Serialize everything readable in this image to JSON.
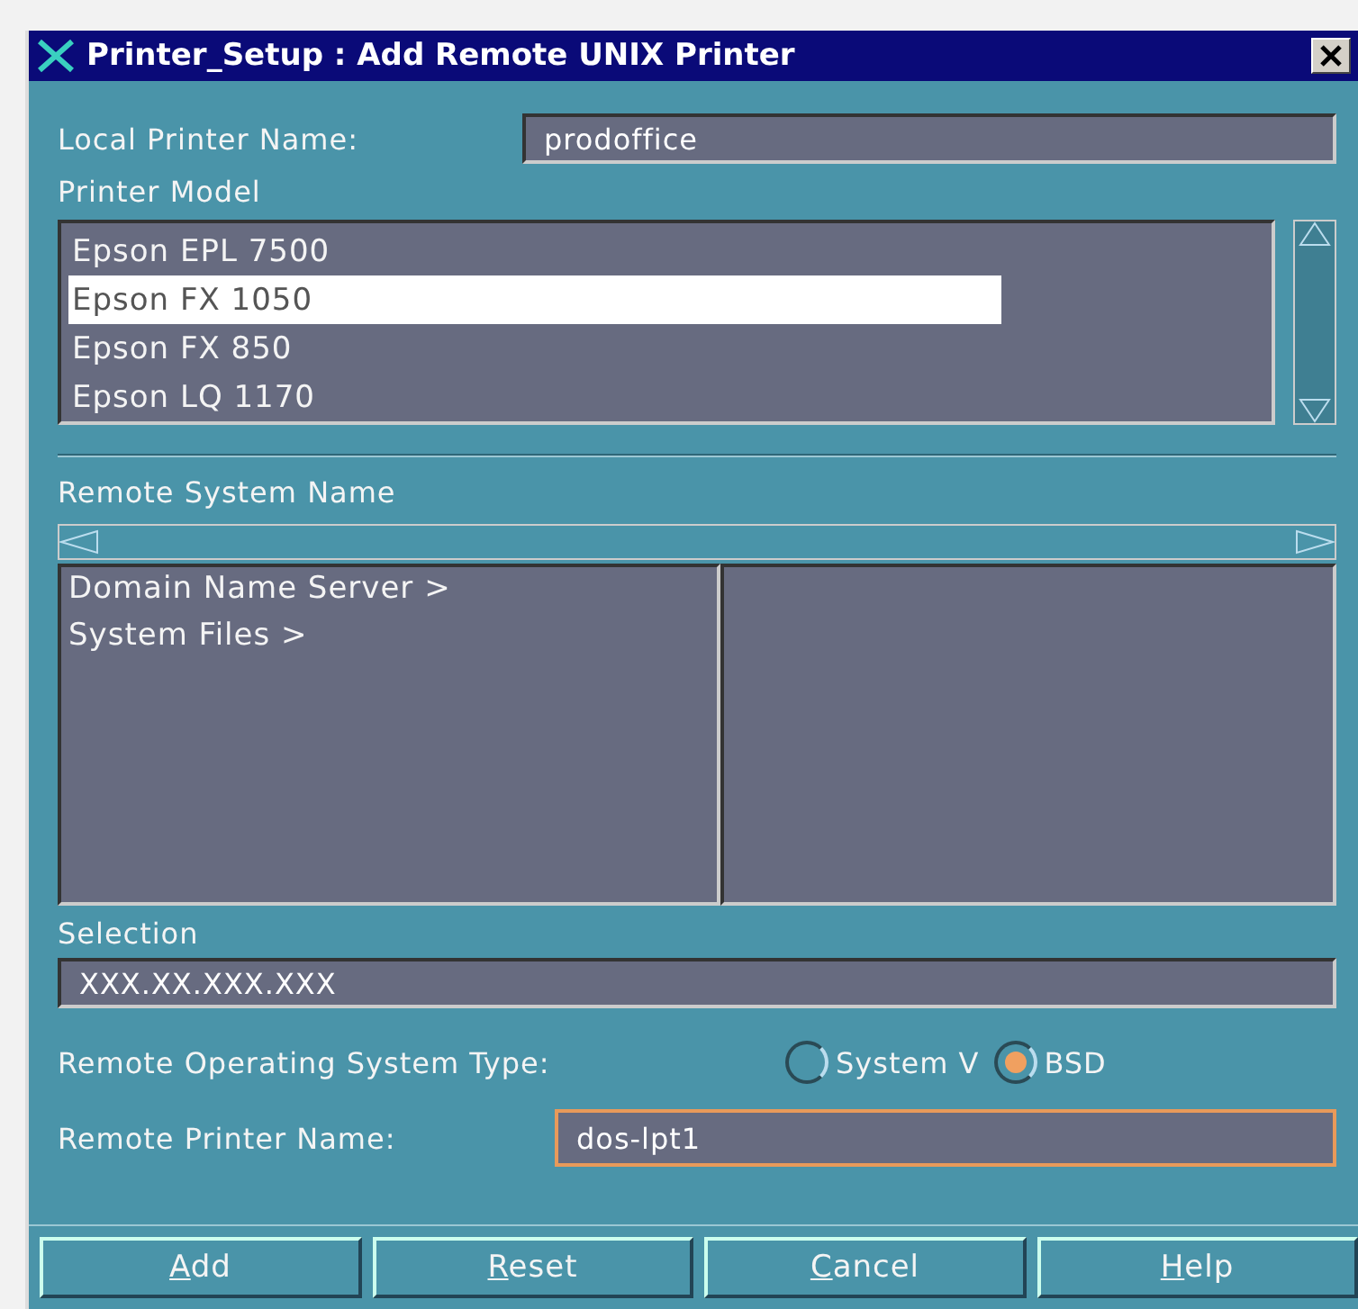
{
  "window": {
    "title": "Printer_Setup : Add Remote UNIX Printer"
  },
  "local_printer_name": {
    "label": "Local Printer Name:",
    "value": "prodoffice"
  },
  "printer_model": {
    "label": "Printer Model",
    "items": [
      {
        "label": "Epson EPL 7500",
        "selected": false
      },
      {
        "label": "Epson FX 1050",
        "selected": true
      },
      {
        "label": "Epson FX 850",
        "selected": false
      },
      {
        "label": "Epson LQ 1170",
        "selected": false
      }
    ]
  },
  "remote_system_name": {
    "label": "Remote System Name",
    "items": [
      {
        "label": "Domain Name Server >"
      },
      {
        "label": "System Files >"
      }
    ]
  },
  "selection": {
    "label": "Selection",
    "value": "XXX.XX.XXX.XXX"
  },
  "os_type": {
    "label": "Remote Operating System Type:",
    "options": [
      {
        "label": "System V",
        "selected": false
      },
      {
        "label": "BSD",
        "selected": true
      }
    ]
  },
  "remote_printer_name": {
    "label": "Remote Printer Name:",
    "value": "dos-lpt1",
    "focused": true
  },
  "buttons": [
    {
      "label": "Add",
      "mnemonic": true
    },
    {
      "label": "Reset",
      "mnemonic": true
    },
    {
      "label": "Cancel",
      "mnemonic": true
    },
    {
      "label": "Help",
      "mnemonic": true
    }
  ]
}
